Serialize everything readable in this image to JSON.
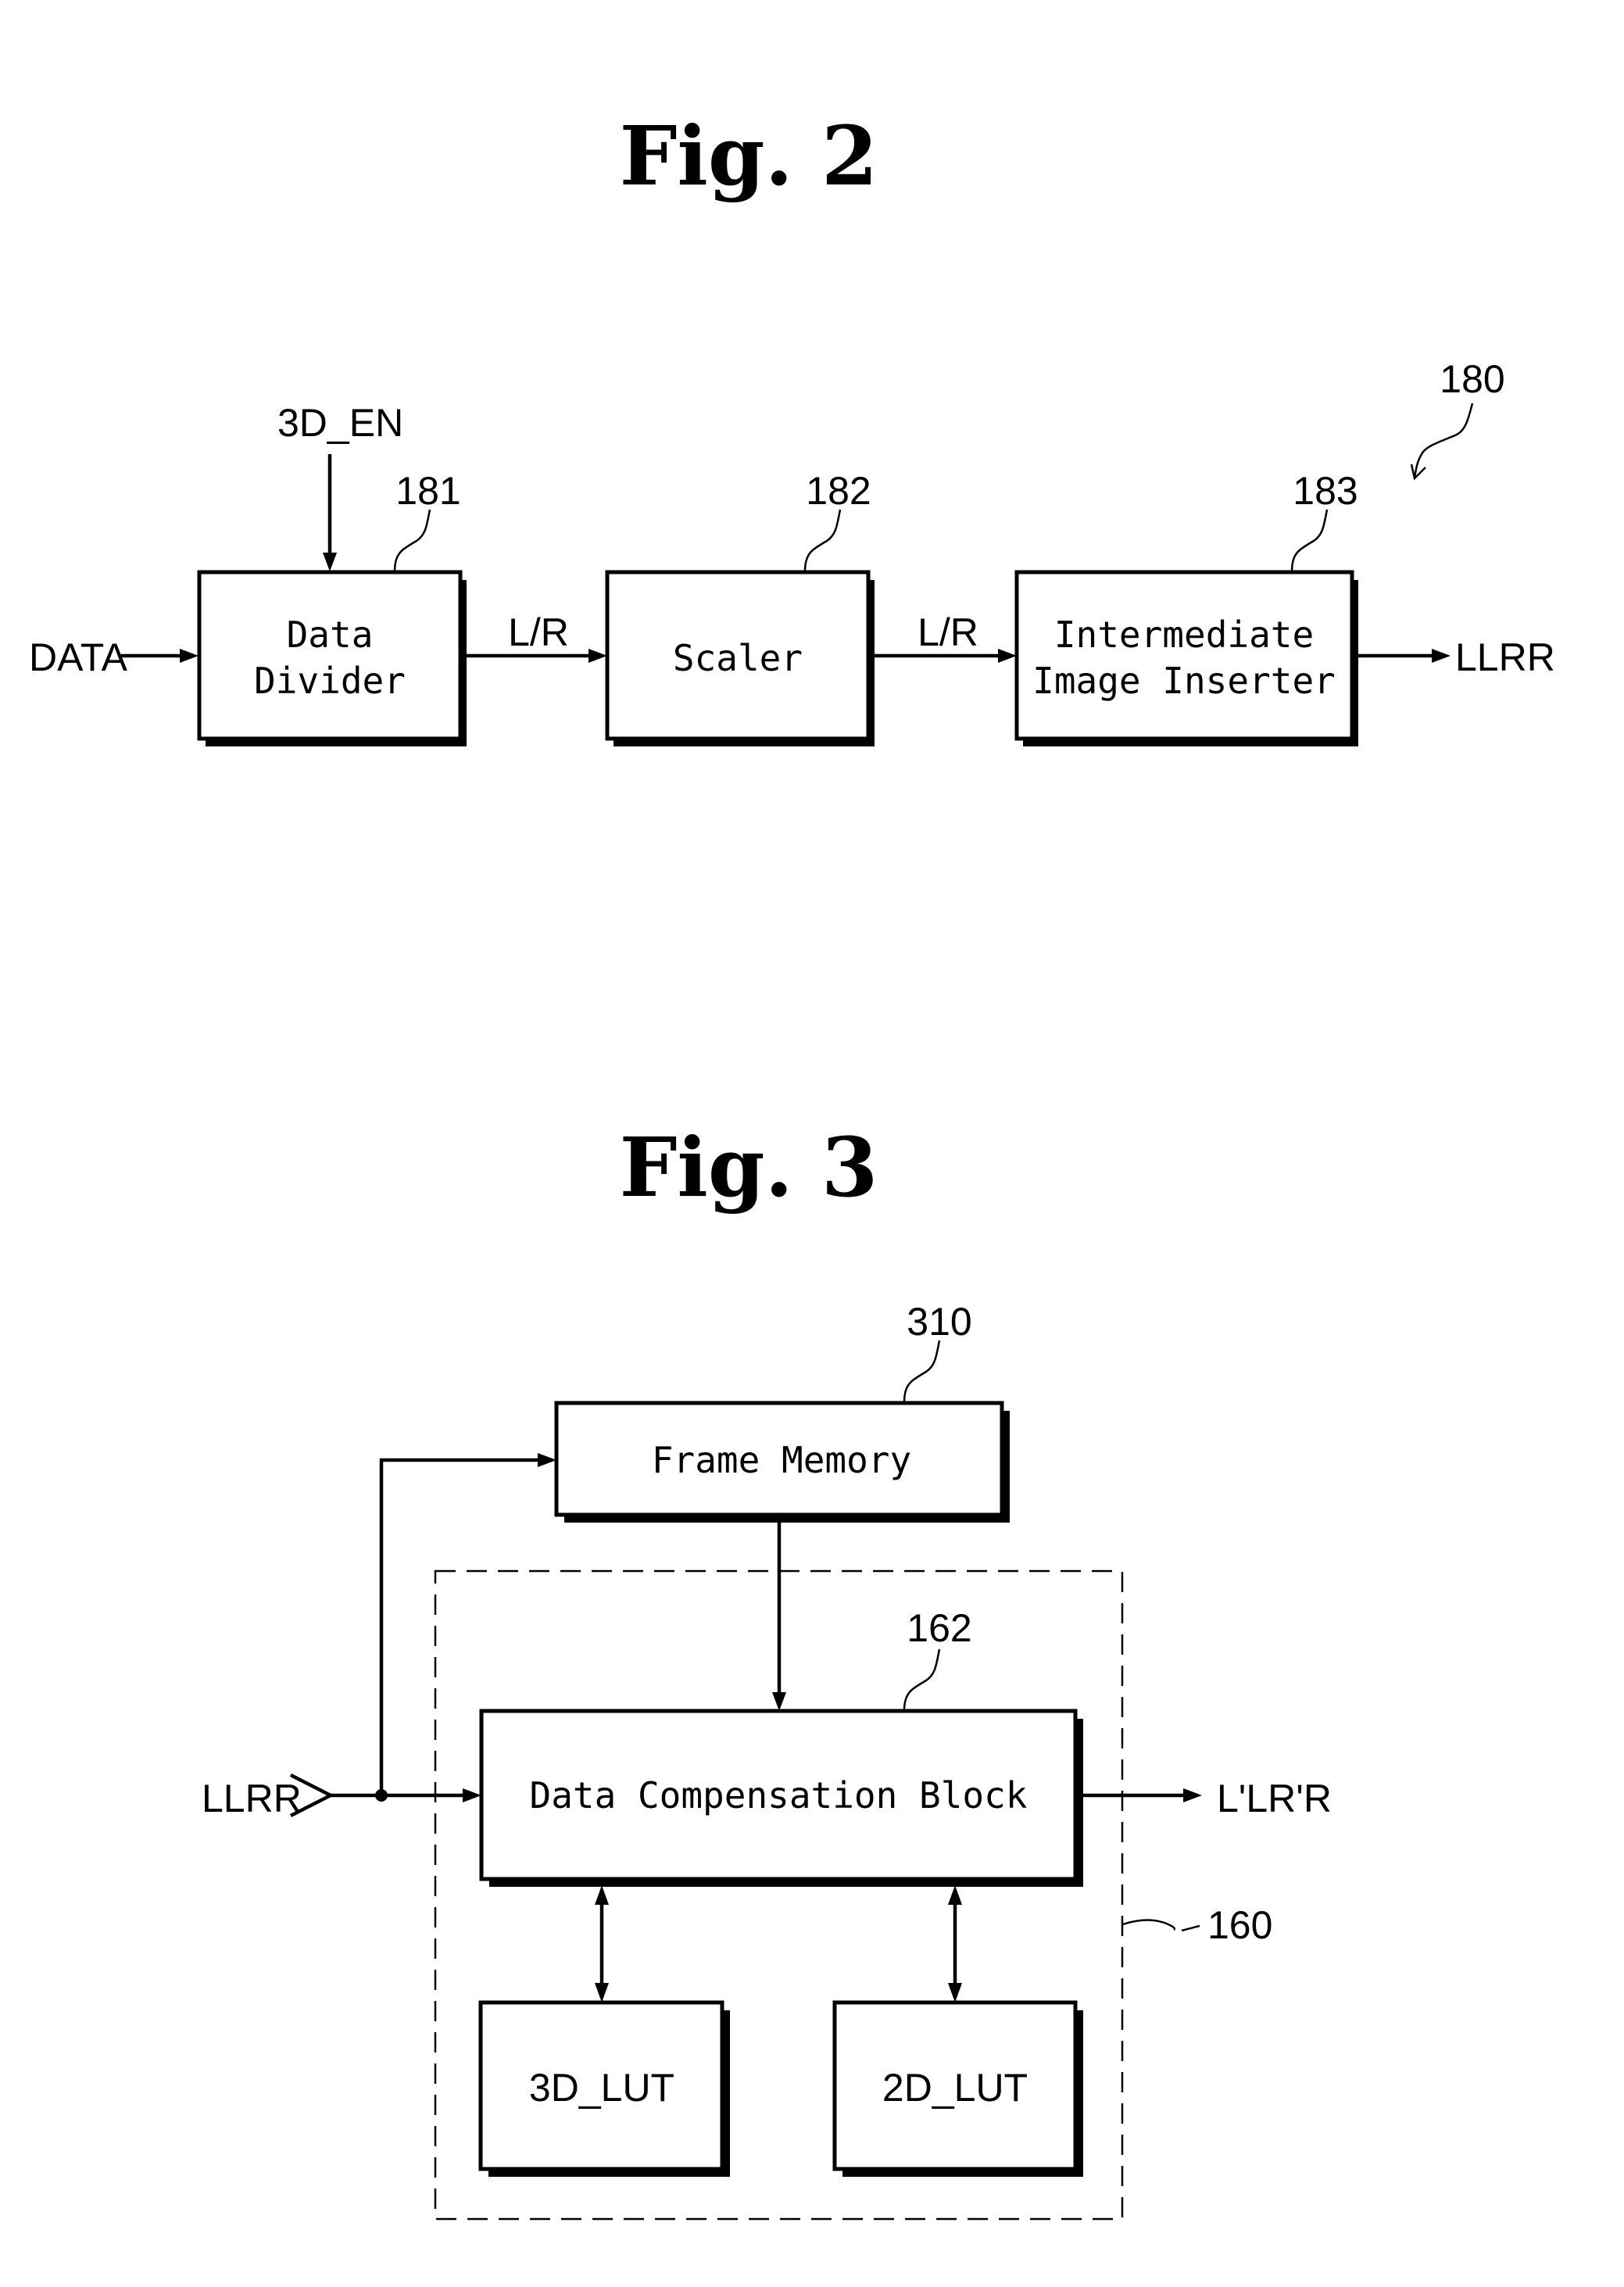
{
  "figure2": {
    "title": "Fig. 2",
    "reference": "180",
    "input_signal": "DATA",
    "control_signal": "3D_EN",
    "output_signal": "LLRR",
    "blocks": [
      {
        "ref": "181",
        "lines": [
          "Data",
          "Divider"
        ]
      },
      {
        "ref": "182",
        "lines": [
          "Scaler"
        ]
      },
      {
        "ref": "183",
        "lines": [
          "Intermediate",
          "Image Inserter"
        ]
      }
    ],
    "links": [
      {
        "label": "L/R"
      },
      {
        "label": "L/R"
      }
    ]
  },
  "figure3": {
    "title": "Fig. 3",
    "input_signal": "LLRR",
    "output_signal": "L'LR'R",
    "group_ref": "160",
    "blocks": {
      "frame_memory": {
        "ref": "310",
        "label": "Frame Memory"
      },
      "data_compensation": {
        "ref": "162",
        "label": "Data Compensation Block"
      },
      "lut_3d": {
        "label": "3D_LUT"
      },
      "lut_2d": {
        "label": "2D_LUT"
      }
    }
  }
}
